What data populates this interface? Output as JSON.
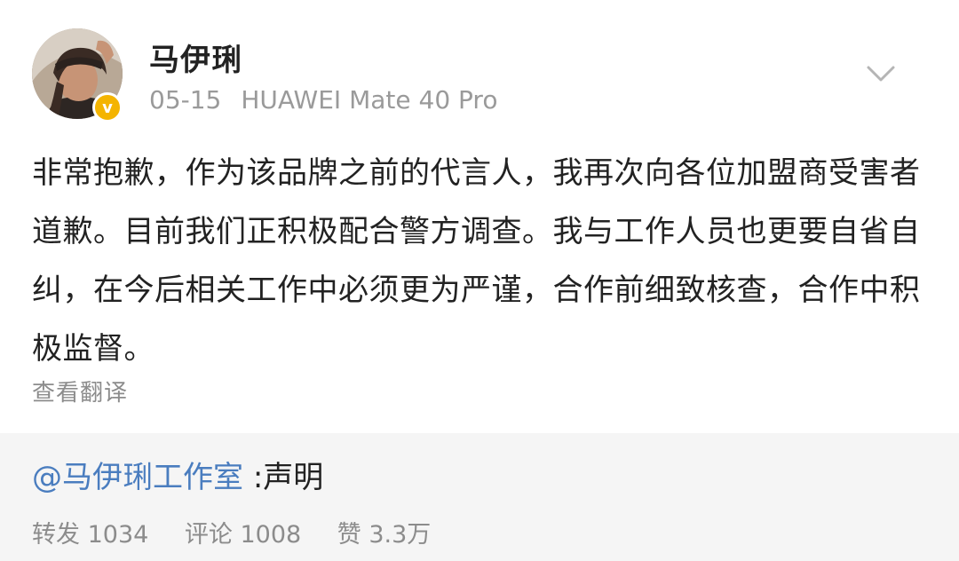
{
  "post": {
    "username": "马伊琍",
    "date": "05-15",
    "device": "HUAWEI Mate 40 Pro",
    "verified_mark": "v",
    "body": "非常抱歉，作为该品牌之前的代言人，我再次向各位加盟商受害者道歉。目前我们正积极配合警方调查。我与工作人员也更要自省自纠，在今后相关工作中必须更为严谨，合作前细致核查，合作中积极监督。",
    "translate_label": "查看翻译"
  },
  "repost": {
    "mention": "@马伊琍工作室",
    "text": ":声明",
    "stats": {
      "reposts": "转发 1034",
      "comments": "评论 1008",
      "likes": "赞 3.3万"
    }
  },
  "colors": {
    "mention": "#4a7dbf",
    "verified_badge": "#f4b400",
    "repost_background": "#f5f5f5"
  },
  "icons": {
    "more": "chevron-down-icon",
    "verified": "verified-badge-icon"
  }
}
